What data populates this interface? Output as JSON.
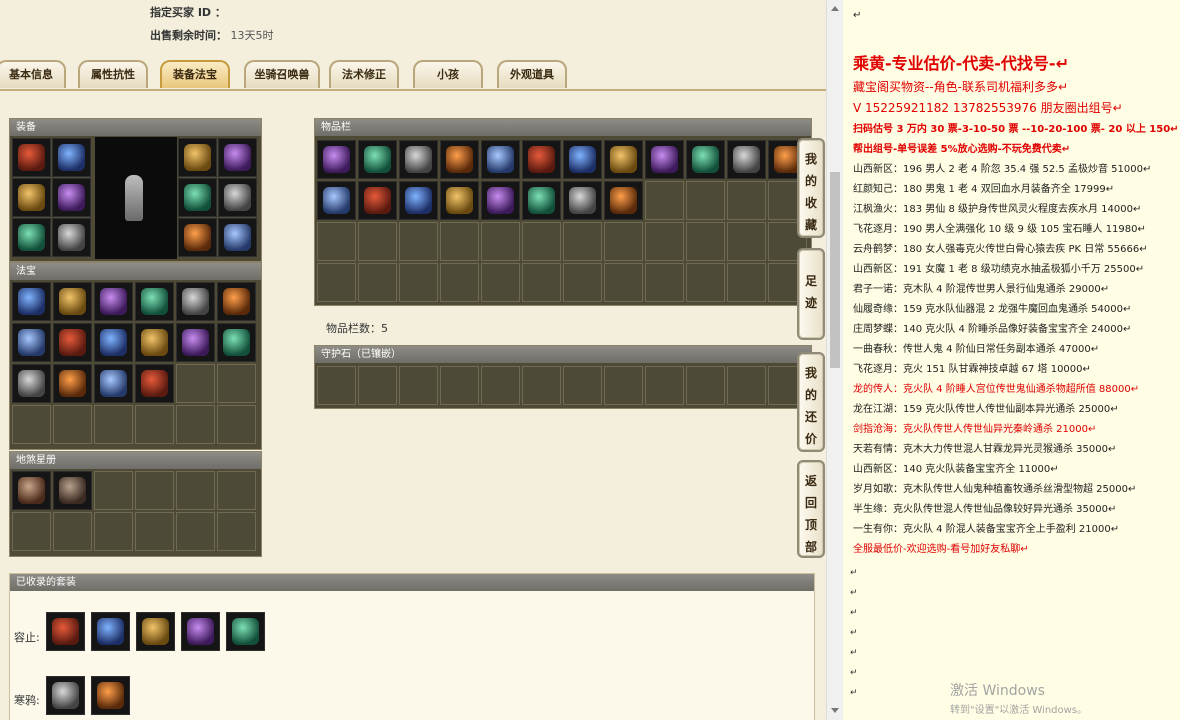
{
  "header": {
    "buyer_label": "指定买家 ID ：",
    "time_label": "出售剩余时间：",
    "time_value": "13天5时"
  },
  "tabs": [
    "基本信息",
    "属性抗性",
    "装备法宝",
    "坐骑召唤兽",
    "法术修正",
    "小孩",
    "外观道具"
  ],
  "panels": {
    "equipment": "装备",
    "treasure": "法宝",
    "star_book": "地煞星册",
    "inventory": "物品栏",
    "inventory_count": "物品栏数：5",
    "guard_stone": "守护石（已镶嵌）",
    "collected_sets": "已收录的套装",
    "set_row1_label": "容止:",
    "set_row2_label": "寒鸦:"
  },
  "side_tabs": [
    "我的收藏",
    "足迹",
    "我的还价",
    "返回顶部"
  ],
  "colors": {
    "accent_red": "#e00000",
    "tab_active": "#e9c77b",
    "panel_bg": "#4f4a35"
  },
  "chat": {
    "lines": [
      {
        "text": "↵",
        "style": ""
      },
      {
        "text": "乘黄-专业估价-代卖-代找号-↵",
        "style": "red big"
      },
      {
        "text": "藏宝阁买物资--角色-联系司机福利多多↵",
        "style": "red mid"
      },
      {
        "text": "V 15225921182    13782553976 朋友圈出组号↵",
        "style": "red mid"
      },
      {
        "text": "扫码估号 3 万内 30 票-3-10-50 票  --10-20-100 票- 20 以上 150↵",
        "style": "red bold"
      },
      {
        "text": "帮出组号-单号误差 5%放心选购-不玩免费代卖↵",
        "style": "red bold"
      },
      {
        "text": "山西新区：196 男人 2 老 4 阶忽 35.4 强 52.5 孟极炒音 51000↵",
        "style": ""
      },
      {
        "text": "红颜知己：180 男鬼 1 老 4 双回血水月装备齐全 17999↵",
        "style": ""
      },
      {
        "text": "江枫渔火：183 男仙 8 级护身传世风灵火程度去疾水月 14000↵",
        "style": ""
      },
      {
        "text": "飞花逐月：190 男人全满强化 10 级 9 级 105 宝石睡人 11980↵",
        "style": ""
      },
      {
        "text": "云舟鹤梦：180 女人强毒克火传世白骨心猿去疾 PK 日常 55666↵",
        "style": ""
      },
      {
        "text": "山西新区：191 女魔 1 老 8 级功绩克水抽孟极狐小千万 25500↵",
        "style": ""
      },
      {
        "text": "君子一诺：克木队 4 阶混传世男人景行仙鬼通杀 29000↵",
        "style": ""
      },
      {
        "text": "仙履奇缘：159 克水队仙器混 2 龙强牛魔回血鬼通杀 54000↵",
        "style": ""
      },
      {
        "text": "庄周梦蝶：140 克火队 4 阶睡杀品像好装备宝宝齐全 24000↵",
        "style": ""
      },
      {
        "text": "一曲春秋：传世人鬼 4 阶仙日常任务副本通杀 47000↵",
        "style": ""
      },
      {
        "text": "飞花逐月：克火 151 队甘霖神技卓越 67 塔 10000↵",
        "style": ""
      },
      {
        "text": "龙的传人：克火队 4 阶睡人宫位传世鬼仙通杀物超所值 88000↵",
        "style": "red"
      },
      {
        "text": "龙在江湖：159 克火队传世人传世仙副本异光通杀 25000↵",
        "style": ""
      },
      {
        "text": "剑指沧海：克火队传世人传世仙异光秦岭通杀 21000↵",
        "style": "red"
      },
      {
        "text": "天若有情：克木大力传世混人甘霖龙异光灵猴通杀 35000↵",
        "style": ""
      },
      {
        "text": "山西新区：140 克火队装备宝宝齐全 11000↵",
        "style": ""
      },
      {
        "text": "岁月如歌：克木队传世人仙鬼种植畜牧通杀丝滑型物超 25000↵",
        "style": ""
      },
      {
        "text": "半生缘：克火队传世混人传世仙品像较好异光通杀 35000↵",
        "style": ""
      },
      {
        "text": "一生有你：克火队 4 阶混人装备宝宝齐全上手盈利 21000↵",
        "style": ""
      },
      {
        "text": "全服最低价-欢迎选购-看号加好友私聊↵",
        "style": "red"
      }
    ]
  },
  "os": {
    "watermark_title": "激活 Windows",
    "watermark_sub": "转到\"设置\"以激活 Windows。"
  }
}
